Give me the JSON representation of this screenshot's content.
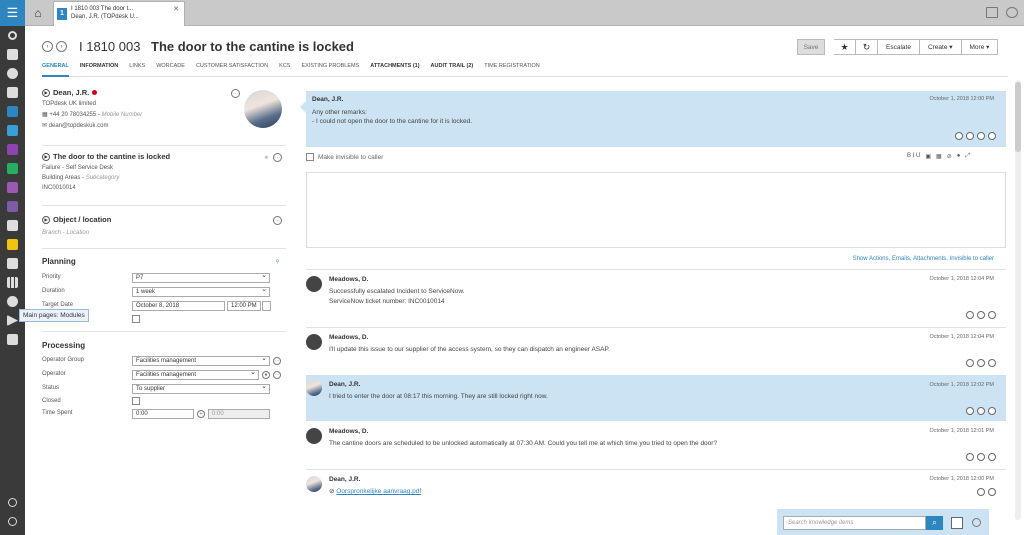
{
  "tab": {
    "line1": "I 1810 003 The door t...",
    "line2": "Dean, J.R. (TOPdesk U...",
    "icon_text": "1"
  },
  "header": {
    "call_number": "I 1810 003",
    "title": "The door to the cantine is locked",
    "save_label": "Save",
    "escalate_label": "Escalate",
    "create_label": "Create ▾",
    "more_label": "More ▾"
  },
  "tabs": [
    {
      "label": "GENERAL"
    },
    {
      "label": "INFORMATION"
    },
    {
      "label": "LINKS"
    },
    {
      "label": "WORCADE"
    },
    {
      "label": "CUSTOMER SATISFACTION"
    },
    {
      "label": "KCS"
    },
    {
      "label": "EXISTING PROBLEMS"
    },
    {
      "label": "ATTACHMENTS (1)"
    },
    {
      "label": "AUDIT TRAIL (2)"
    },
    {
      "label": "TIME REGISTRATION"
    }
  ],
  "caller": {
    "name": "Dean, J.R.",
    "company": "TOPdesk UK limited",
    "phone": "+44 20 78034255",
    "mobile_placeholder": "Mobile Number",
    "email": "dean@topdeskuk.com"
  },
  "request": {
    "title": "The door to the cantine is locked",
    "category": "Failure",
    "subcategory": "Self Service Desk",
    "area": "Building Areas",
    "area_sub": "Subcategory",
    "external_number": "INC0010014"
  },
  "object": {
    "title": "Object / location",
    "branch": "Branch",
    "location": "Location"
  },
  "planning": {
    "heading": "Planning",
    "priority_label": "Priority",
    "priority": "P7",
    "duration_label": "Duration",
    "duration": "1 week",
    "target_label": "Target Date",
    "target_date": "October 8, 2018",
    "target_time": "12:00 PM"
  },
  "processing": {
    "heading": "Processing",
    "group_label": "Operator Group",
    "group": "Facilities management",
    "operator_label": "Operator",
    "operator": "Facilities management",
    "status_label": "Status",
    "status": "To supplier",
    "closed_label": "Closed",
    "time_label": "Time Spent",
    "time_a": "0:00",
    "time_b": "0:00"
  },
  "tooltip": "Main pages: Modules",
  "request_entry": {
    "name": "Dean, J.R.",
    "date": "October 1, 2018 12:00 PM",
    "line1": "Any other remarks:",
    "line2": "- I could not open the door to the cantine for it is locked."
  },
  "compose": {
    "invisible_label": "Make invisible to caller",
    "show_link": "Show Actions, Emails, Attachments, Invisible to caller",
    "toolbar": "B  I  U"
  },
  "entries": [
    {
      "name": "Meadows, D.",
      "date": "October 1, 2018 12:04 PM",
      "line1": "Successfully escalated Incident to ServiceNow.",
      "line2": " ServiceNow ticket number: INC0010014"
    },
    {
      "name": "Meadows, D.",
      "date": "October 1, 2018 12:04 PM",
      "line1": "I'll update this issue to our supplier of the access system, so they can dispatch an engineer ASAP."
    },
    {
      "name": "Dean, J.R.",
      "date": "October 1, 2018 12:02 PM",
      "line1": "I tried to enter the door at 08:17 this morning. They are still locked right now."
    },
    {
      "name": "Meadows, D.",
      "date": "October 1, 2018 12:01 PM",
      "line1": "The cantine doors are scheduled to be unlocked automatically at 07:30 AM. Could you tell me at which time you tried to open the door?"
    },
    {
      "name": "Dean, J.R.",
      "date": "October 1, 2018 12:00 PM",
      "attachment": "Oorspronkelijke aanvraag.pdf"
    }
  ],
  "knowledge": {
    "placeholder": "Search knowledge items"
  },
  "colors": {
    "accent": "#2e86c1",
    "highlight": "#cbe3f3",
    "rail": "#3a3a3a"
  }
}
